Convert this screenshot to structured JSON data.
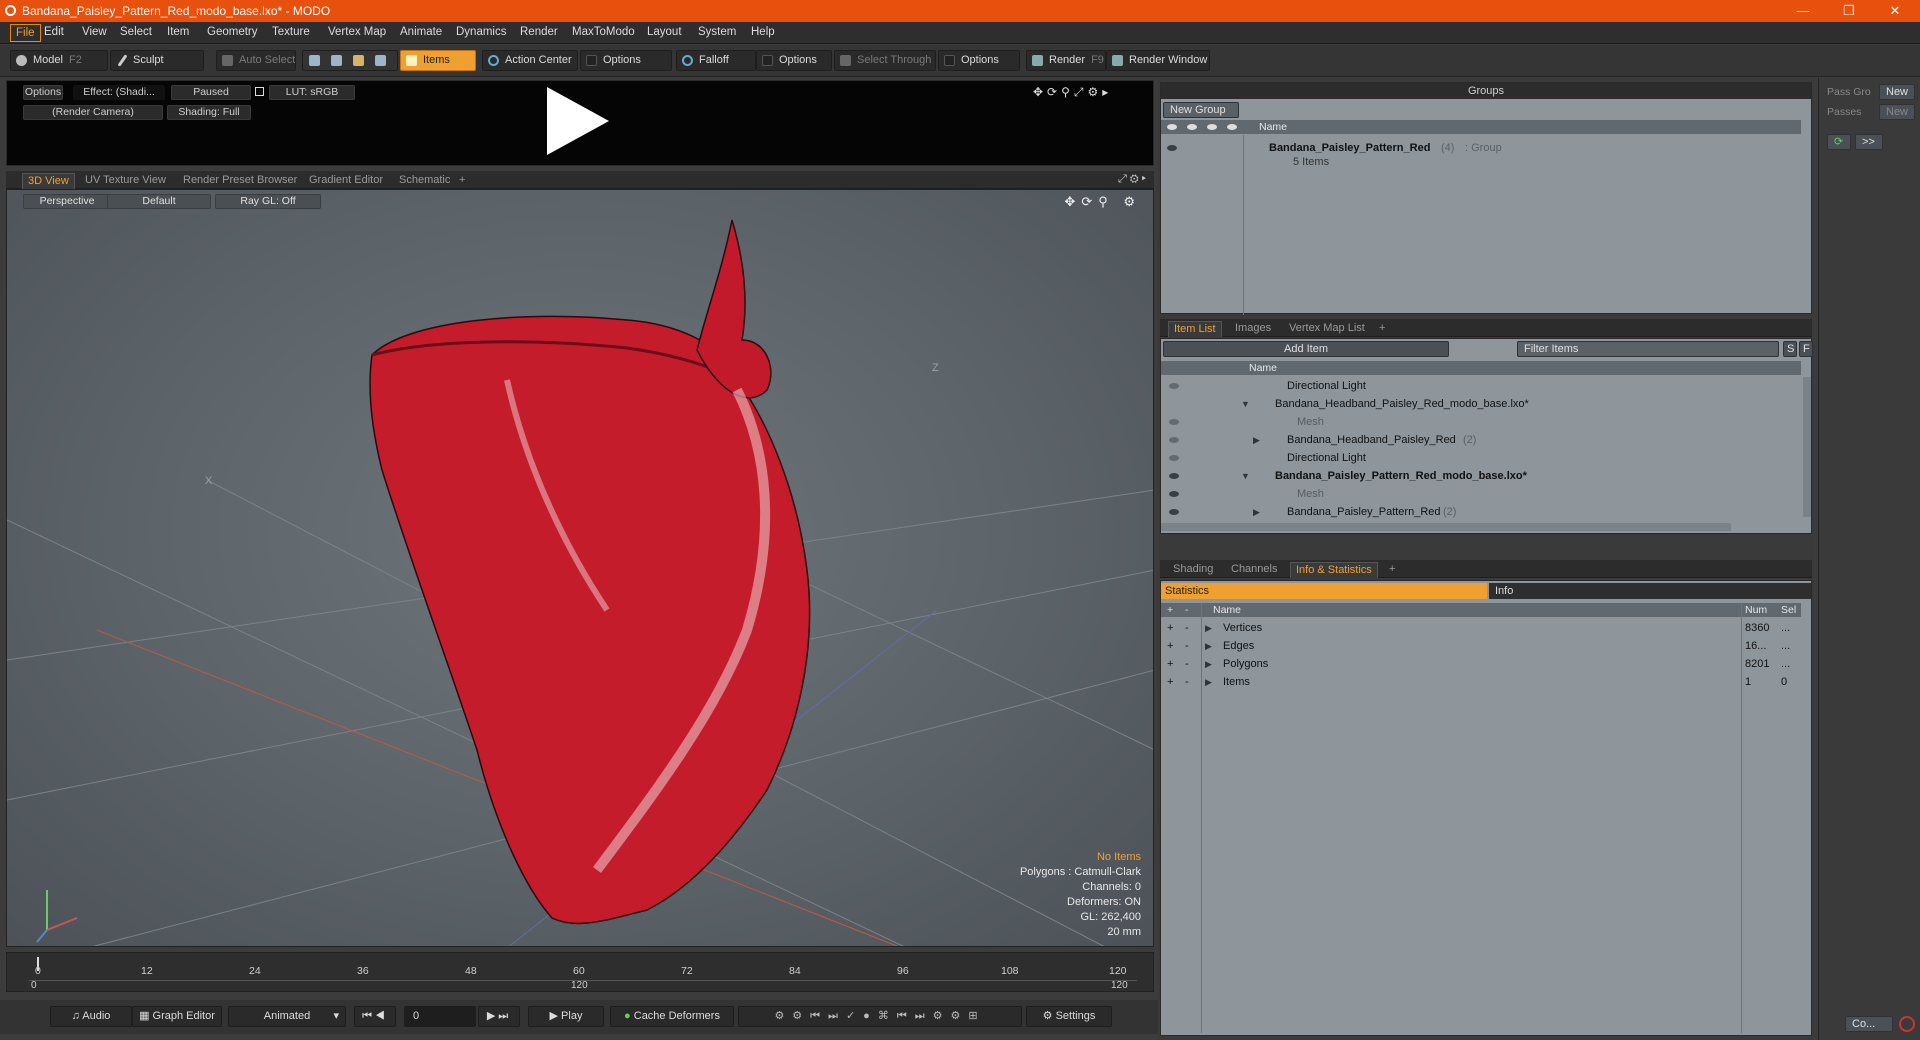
{
  "window": {
    "title": "Bandana_Paisley_Pattern_Red_modo_base.lxo* - MODO",
    "controls": [
      "—",
      "❐",
      "✕"
    ]
  },
  "menu": [
    "File",
    "Edit",
    "View",
    "Select",
    "Item",
    "Geometry",
    "Texture",
    "Vertex Map",
    "Animate",
    "Dynamics",
    "Render",
    "MaxToModo",
    "Layout",
    "System",
    "Help"
  ],
  "toolbar": {
    "model": "Model",
    "model_key": "F2",
    "sculpt": "Sculpt",
    "auto_select": "Auto Select",
    "items": "Items",
    "action_center": "Action Center",
    "options1": "Options",
    "falloff": "Falloff",
    "options2": "Options",
    "select_through": "Select Through",
    "options3": "Options",
    "render": "Render",
    "render_key": "F9",
    "render_window": "Render Window"
  },
  "preview": {
    "options": "Options",
    "effect": "Effect: (Shadi...",
    "paused": "Paused",
    "lut": "LUT: sRGB",
    "camera": "(Render Camera)",
    "shading": "Shading: Full"
  },
  "viewtabs": [
    "3D View",
    "UV Texture View",
    "Render Preset Browser",
    "Gradient Editor",
    "Schematic",
    "+"
  ],
  "viewport": {
    "perspective": "Perspective",
    "default": "Default",
    "raygl": "Ray GL: Off",
    "axis_x": "X",
    "axis_z": "Z",
    "info": {
      "no_items": "No Items",
      "polygons": "Polygons : Catmull-Clark",
      "channels": "Channels: 0",
      "deformers": "Deformers: ON",
      "gl": "GL: 262,400",
      "scale": "20 mm"
    }
  },
  "timeline": {
    "ticks": [
      "0",
      "12",
      "24",
      "36",
      "48",
      "60",
      "72",
      "84",
      "96",
      "108",
      "120"
    ],
    "sub_ticks": [
      "0",
      "120",
      "120"
    ]
  },
  "transport": {
    "audio": "Audio",
    "graph_editor": "Graph Editor",
    "animated": "Animated",
    "frame": "0",
    "play": "Play",
    "cache_deformers": "Cache Deformers",
    "settings": "Settings"
  },
  "groups": {
    "title": "Groups",
    "new_group": "New Group",
    "col_name": "Name",
    "item_name": "Bandana_Paisley_Pattern_Red",
    "item_count": "(4)",
    "item_type": ": Group",
    "item_sub": "5 Items"
  },
  "itemlist": {
    "tabs": [
      "Item List",
      "Images",
      "Vertex Map List",
      "+"
    ],
    "add_item": "Add Item",
    "filter": "Filter Items",
    "btn_s": "S",
    "btn_f": "F",
    "col_name": "Name",
    "rows": [
      {
        "label": "Directional Light",
        "extra": ""
      },
      {
        "label": "Bandana_Headband_Paisley_Red_modo_base.lxo*",
        "extra": ""
      },
      {
        "label": "Mesh",
        "extra": ""
      },
      {
        "label": "Bandana_Headband_Paisley_Red",
        "extra": "(2)"
      },
      {
        "label": "Directional Light",
        "extra": ""
      },
      {
        "label": "Bandana_Paisley_Pattern_Red_modo_base.lxo*",
        "extra": ""
      },
      {
        "label": "Mesh",
        "extra": ""
      },
      {
        "label": "Bandana_Paisley_Pattern_Red",
        "extra": "(2)"
      }
    ]
  },
  "stats": {
    "tabs": [
      "Shading",
      "Channels",
      "Info & Statistics",
      "+"
    ],
    "statistics": "Statistics",
    "info": "Info",
    "col_name": "Name",
    "col_num": "Num",
    "col_sel": "Sel",
    "rows": [
      {
        "name": "Vertices",
        "num": "8360",
        "sel": "..."
      },
      {
        "name": "Edges",
        "num": "16...",
        "sel": "..."
      },
      {
        "name": "Polygons",
        "num": "8201",
        "sel": "..."
      },
      {
        "name": "Items",
        "num": "1",
        "sel": "0"
      }
    ]
  },
  "farright": {
    "pass_group": "Pass Gro",
    "passes": "Passes",
    "new1": "New",
    "new2": "New",
    "more": ">>",
    "bottom": "Co..."
  }
}
